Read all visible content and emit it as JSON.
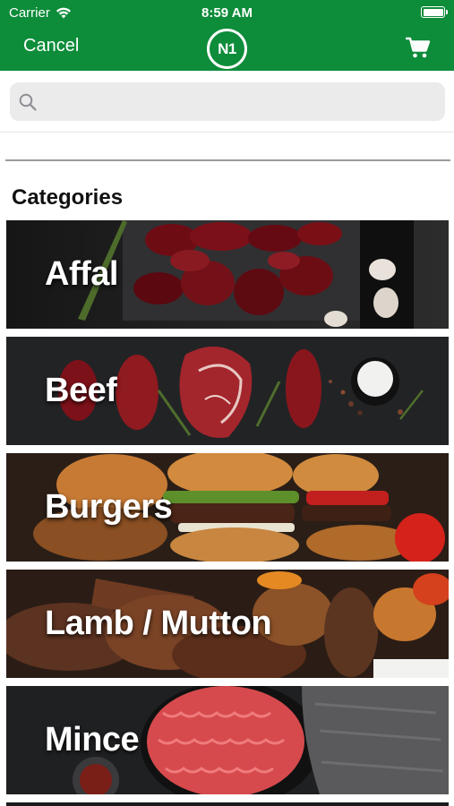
{
  "status_bar": {
    "carrier": "Carrier",
    "time": "8:59 AM"
  },
  "nav": {
    "cancel_label": "Cancel",
    "logo_text": "N1",
    "cart_icon": "cart-icon",
    "accent_color": "#0d8c3a"
  },
  "search": {
    "placeholder": "",
    "value": "",
    "icon": "search-icon"
  },
  "section_title": "Categories",
  "categories": [
    {
      "label": "Affal"
    },
    {
      "label": "Beef"
    },
    {
      "label": "Burgers"
    },
    {
      "label": "Lamb / Mutton"
    },
    {
      "label": "Mince"
    }
  ]
}
